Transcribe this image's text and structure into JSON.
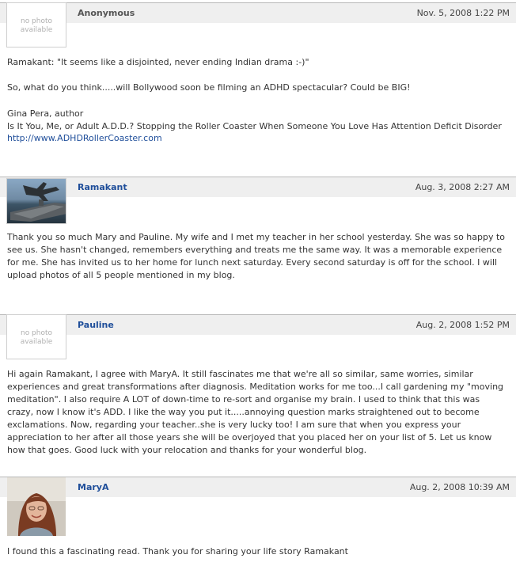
{
  "comments": [
    {
      "author": "Anonymous",
      "date": "Nov. 5, 2008 1:22 PM",
      "avatar": "no-photo",
      "no_photo_text": "no photo available",
      "paragraphs": [
        "Ramakant: \"It seems like a disjointed, never ending Indian drama :-)\"",
        "So, what do you think.....will Bollywood soon be filming an ADHD spectacular? Could be BIG!",
        "Gina Pera, author",
        "Is It You, Me, or Adult A.D.D.? Stopping the Roller Coaster When Someone You Love Has Attention Deficit Disorder"
      ],
      "link": "http://www.ADHDRollerCoaster.com"
    },
    {
      "author": "Ramakant",
      "date": "Aug. 3, 2008 2:27 AM",
      "avatar": "photo-aircraft-carrier",
      "text": "Thank you so much Mary and Pauline. My wife and I met my teacher in her school yesterday. She was so happy to see us. She hasn't changed, remembers everything and treats me the same way. It was a memorable experience for me. She has invited us to her home for lunch next saturday. Every second saturday is off for the school. I will upload photos of all 5 people mentioned in my blog."
    },
    {
      "author": "Pauline",
      "date": "Aug. 2, 2008 1:52 PM",
      "avatar": "no-photo",
      "no_photo_text": "no photo available",
      "text": "Hi again Ramakant, I agree with MaryA. It still fascinates me that we're all so similar, same worries, similar experiences and great transformations after diagnosis. Meditation works for me too...I call gardening my \"moving meditation\". I also require A LOT of down-time to re-sort and organise my brain. I used to think that this was crazy, now I know it's ADD. I like the way you put it.....annoying question marks straightened out to become exclamations. Now, regarding your teacher..she is very lucky too! I am sure that when you express your appreciation to her after all those years she will be overjoyed that you placed her on your list of 5. Let us know how that goes. Good luck with your relocation and thanks for your wonderful blog."
    },
    {
      "author": "MaryA",
      "date": "Aug. 2, 2008 10:39 AM",
      "avatar": "photo-woman-portrait",
      "text": "I found this a fascinating read. Thank you for sharing your life story Ramakant"
    }
  ]
}
